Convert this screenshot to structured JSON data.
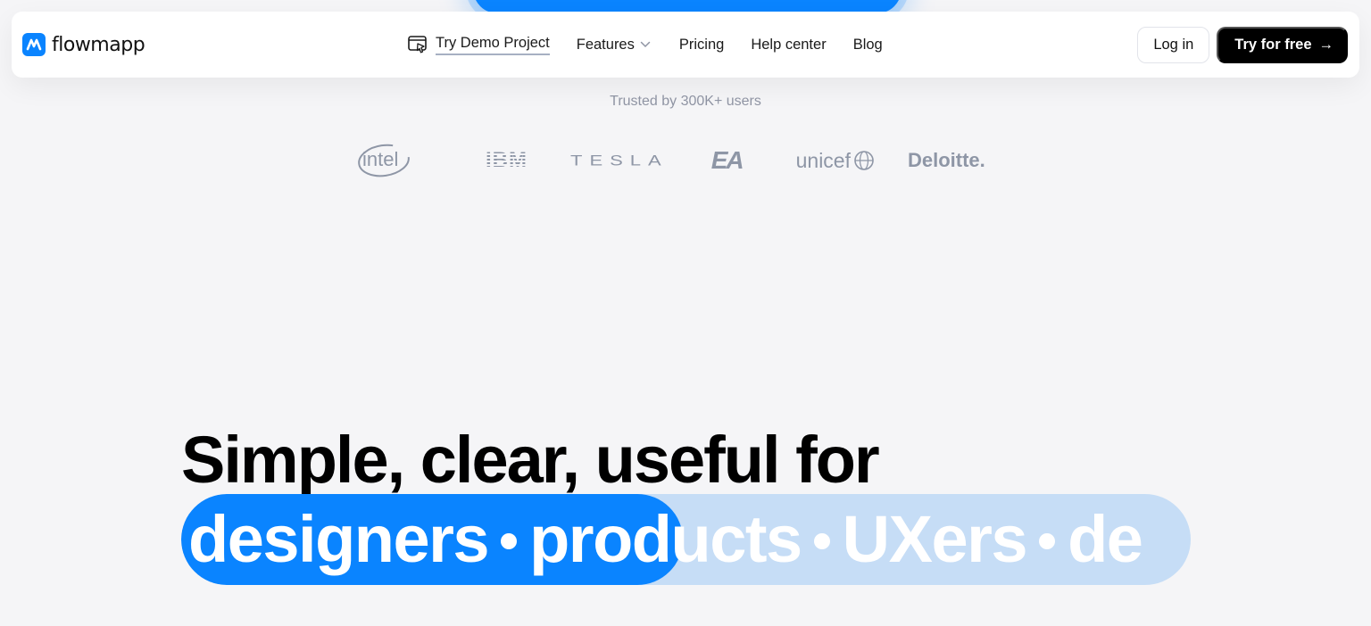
{
  "nav": {
    "logo_text": "flowmapp",
    "demo_label": "Try Demo Project",
    "features_label": "Features",
    "pricing_label": "Pricing",
    "help_label": "Help center",
    "blog_label": "Blog",
    "login_label": "Log in",
    "try_label": "Try for free",
    "try_arrow": "→"
  },
  "trusted": {
    "text": "Trusted by 300K+ users",
    "brands": [
      "intel",
      "IBM",
      "TESLA",
      "EA",
      "unicef",
      "Deloitte."
    ]
  },
  "hero": {
    "headline": "Simple, clear, useful for",
    "rotating": [
      "designers",
      "products",
      "UXers",
      "de"
    ]
  },
  "colors": {
    "accent": "#0a84ff",
    "accent_light": "#c6ddf6",
    "background": "#f5f5f7"
  }
}
